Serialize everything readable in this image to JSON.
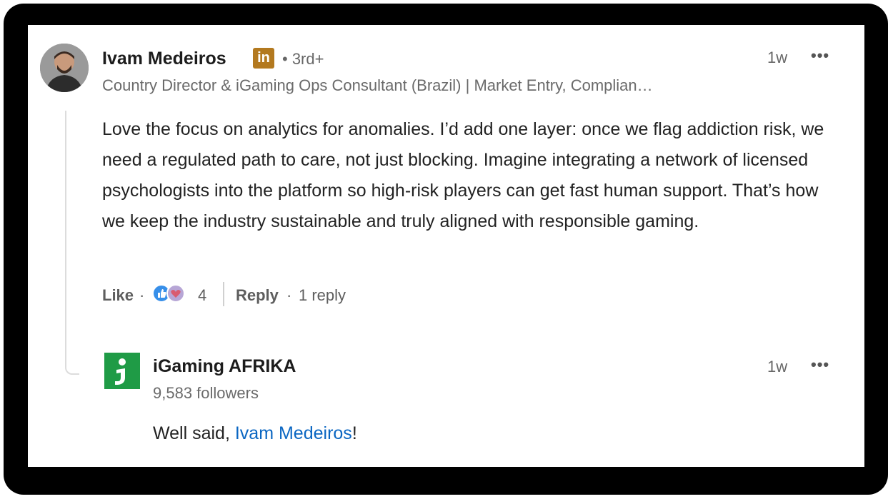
{
  "comment": {
    "author": "Ivam Medeiros",
    "badge": "in",
    "degree": "• 3rd+",
    "time": "1w",
    "more": "•••",
    "headline": "Country Director & iGaming Ops Consultant (Brazil) | Market Entry, Complian…",
    "text": "Love the focus on analytics for anomalies. I’d add one layer: once we flag addiction risk, we need a regulated path to care, not just blocking. Imagine integrating a network of licensed psychologists into the platform so high-risk players can get fast human support. That’s how we keep the industry sustainable and truly aligned with responsible gaming.",
    "actions": {
      "like": "Like",
      "dot1": "·",
      "reaction_count": "4",
      "reply": "Reply",
      "dot2": "·",
      "reply_count": "1 reply"
    }
  },
  "reply": {
    "author": "iGaming AFRIKA",
    "followers": "9,583 followers",
    "time": "1w",
    "more": "•••",
    "text_before": "Well said, ",
    "mention": "Ivam Medeiros",
    "text_after": "!"
  },
  "colors": {
    "mention": "#0a66c2",
    "logo_green": "#1f9b46",
    "linkedin_badge": "#b3791f"
  },
  "icons": {
    "reactions": [
      "like-reaction-icon",
      "love-reaction-icon"
    ],
    "author_logo": "igaming-afrika-logo"
  }
}
